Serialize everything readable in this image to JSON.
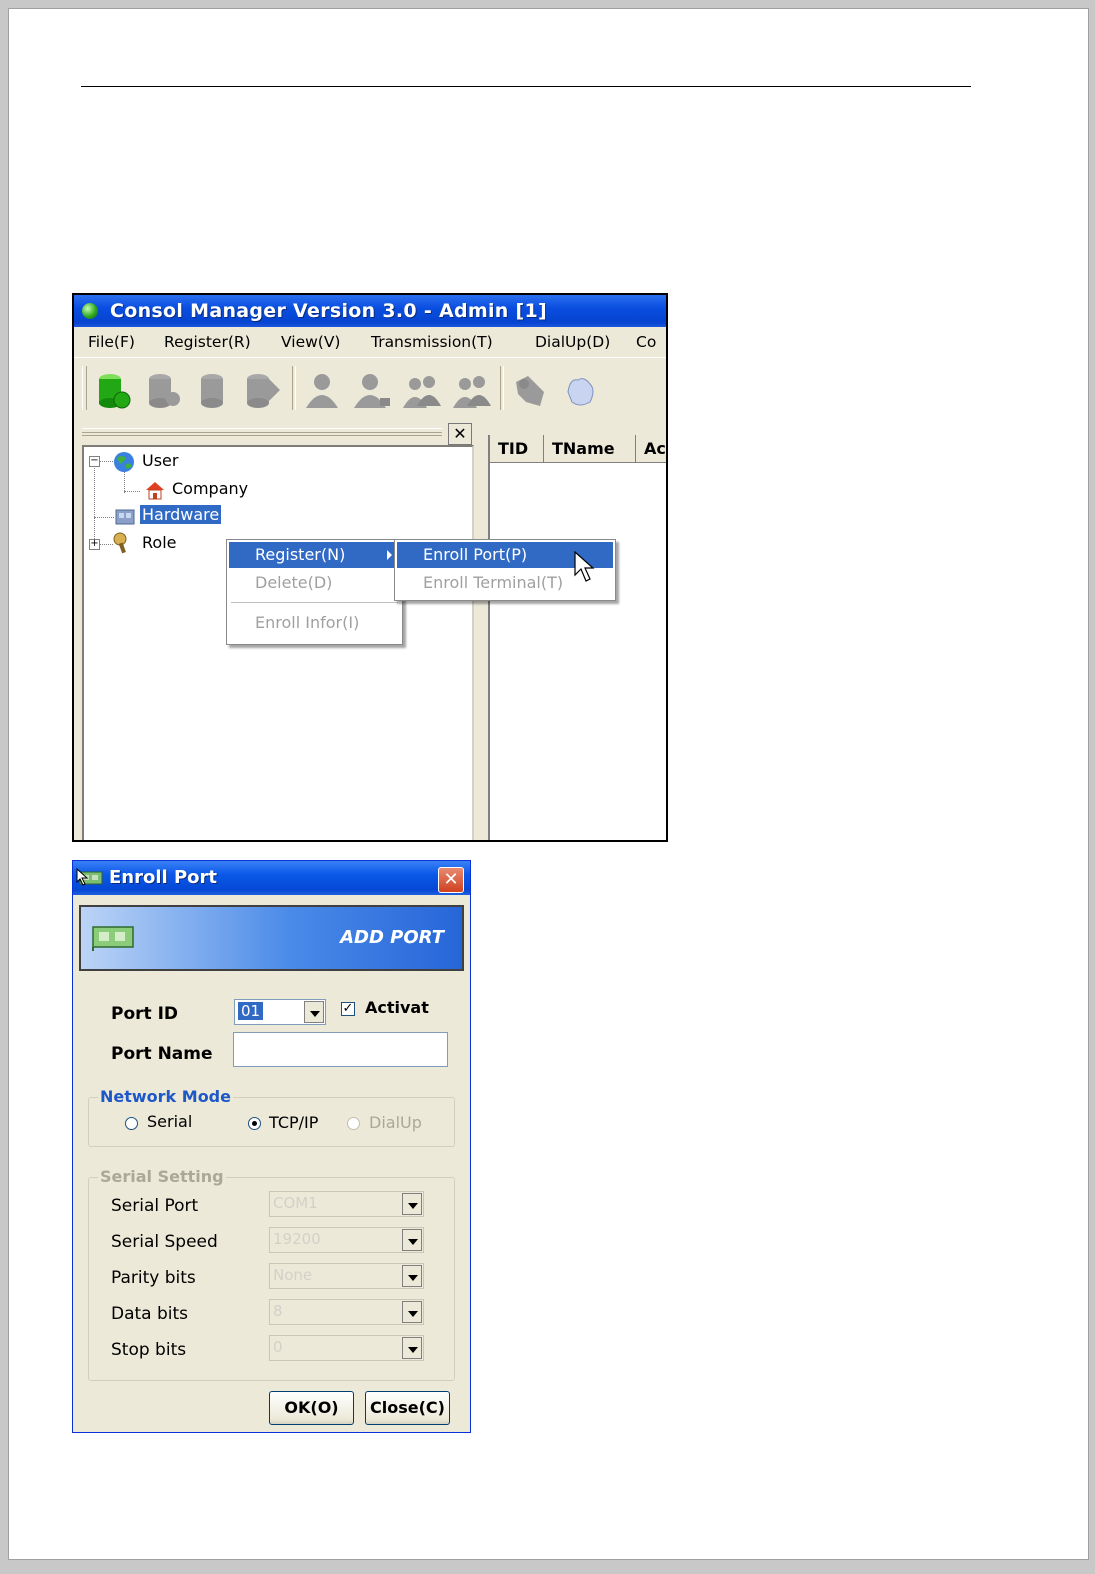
{
  "main_window": {
    "title": "Consol Manager Version 3.0 - Admin [1]",
    "menu": [
      "File(F)",
      "Register(R)",
      "View(V)",
      "Transmission(T)",
      "DialUp(D)",
      "Co"
    ],
    "toolbar_icons": [
      "db-connect-icon",
      "db-disconnect-icon",
      "db-icon",
      "db-close-icon",
      "user-icon",
      "user-edit-icon",
      "users-icon",
      "users-group-icon",
      "role-icon",
      "hand-icon"
    ],
    "tree": {
      "user": "User",
      "company": "Company",
      "hardware": "Hardware",
      "role": "Role"
    },
    "table_headers": [
      "TID",
      "TName",
      "Ac"
    ],
    "context_menu": {
      "register": "Register(N)",
      "delete": "Delete(D)",
      "enroll_infor": "Enroll Infor(I)"
    },
    "submenu": {
      "enroll_port": "Enroll Port(P)",
      "enroll_terminal": "Enroll Terminal(T)"
    }
  },
  "dialog": {
    "title": "Enroll Port",
    "banner": "ADD PORT",
    "port_id_label": "Port ID",
    "port_id_value": "01",
    "activate_label": "Activat",
    "activate_checked": true,
    "port_name_label": "Port Name",
    "port_name_value": "",
    "network_mode": {
      "legend": "Network Mode",
      "serial": "Serial",
      "tcpip": "TCP/IP",
      "dialup": "DialUp",
      "selected": "TCP/IP"
    },
    "serial_setting": {
      "legend": "Serial Setting",
      "serial_port_label": "Serial Port",
      "serial_port_value": "COM1",
      "serial_speed_label": "Serial Speed",
      "serial_speed_value": "19200",
      "parity_label": "Parity bits",
      "parity_value": "None",
      "data_bits_label": "Data bits",
      "data_bits_value": "8",
      "stop_bits_label": "Stop bits",
      "stop_bits_value": "0"
    },
    "ok_button": "OK(O)",
    "close_button": "Close(C)"
  },
  "colors": {
    "xp_title_blue": "#0a4ee0",
    "selection_blue": "#316ac5",
    "window_bg": "#ece9d8",
    "legend_blue": "#1e58c8"
  }
}
